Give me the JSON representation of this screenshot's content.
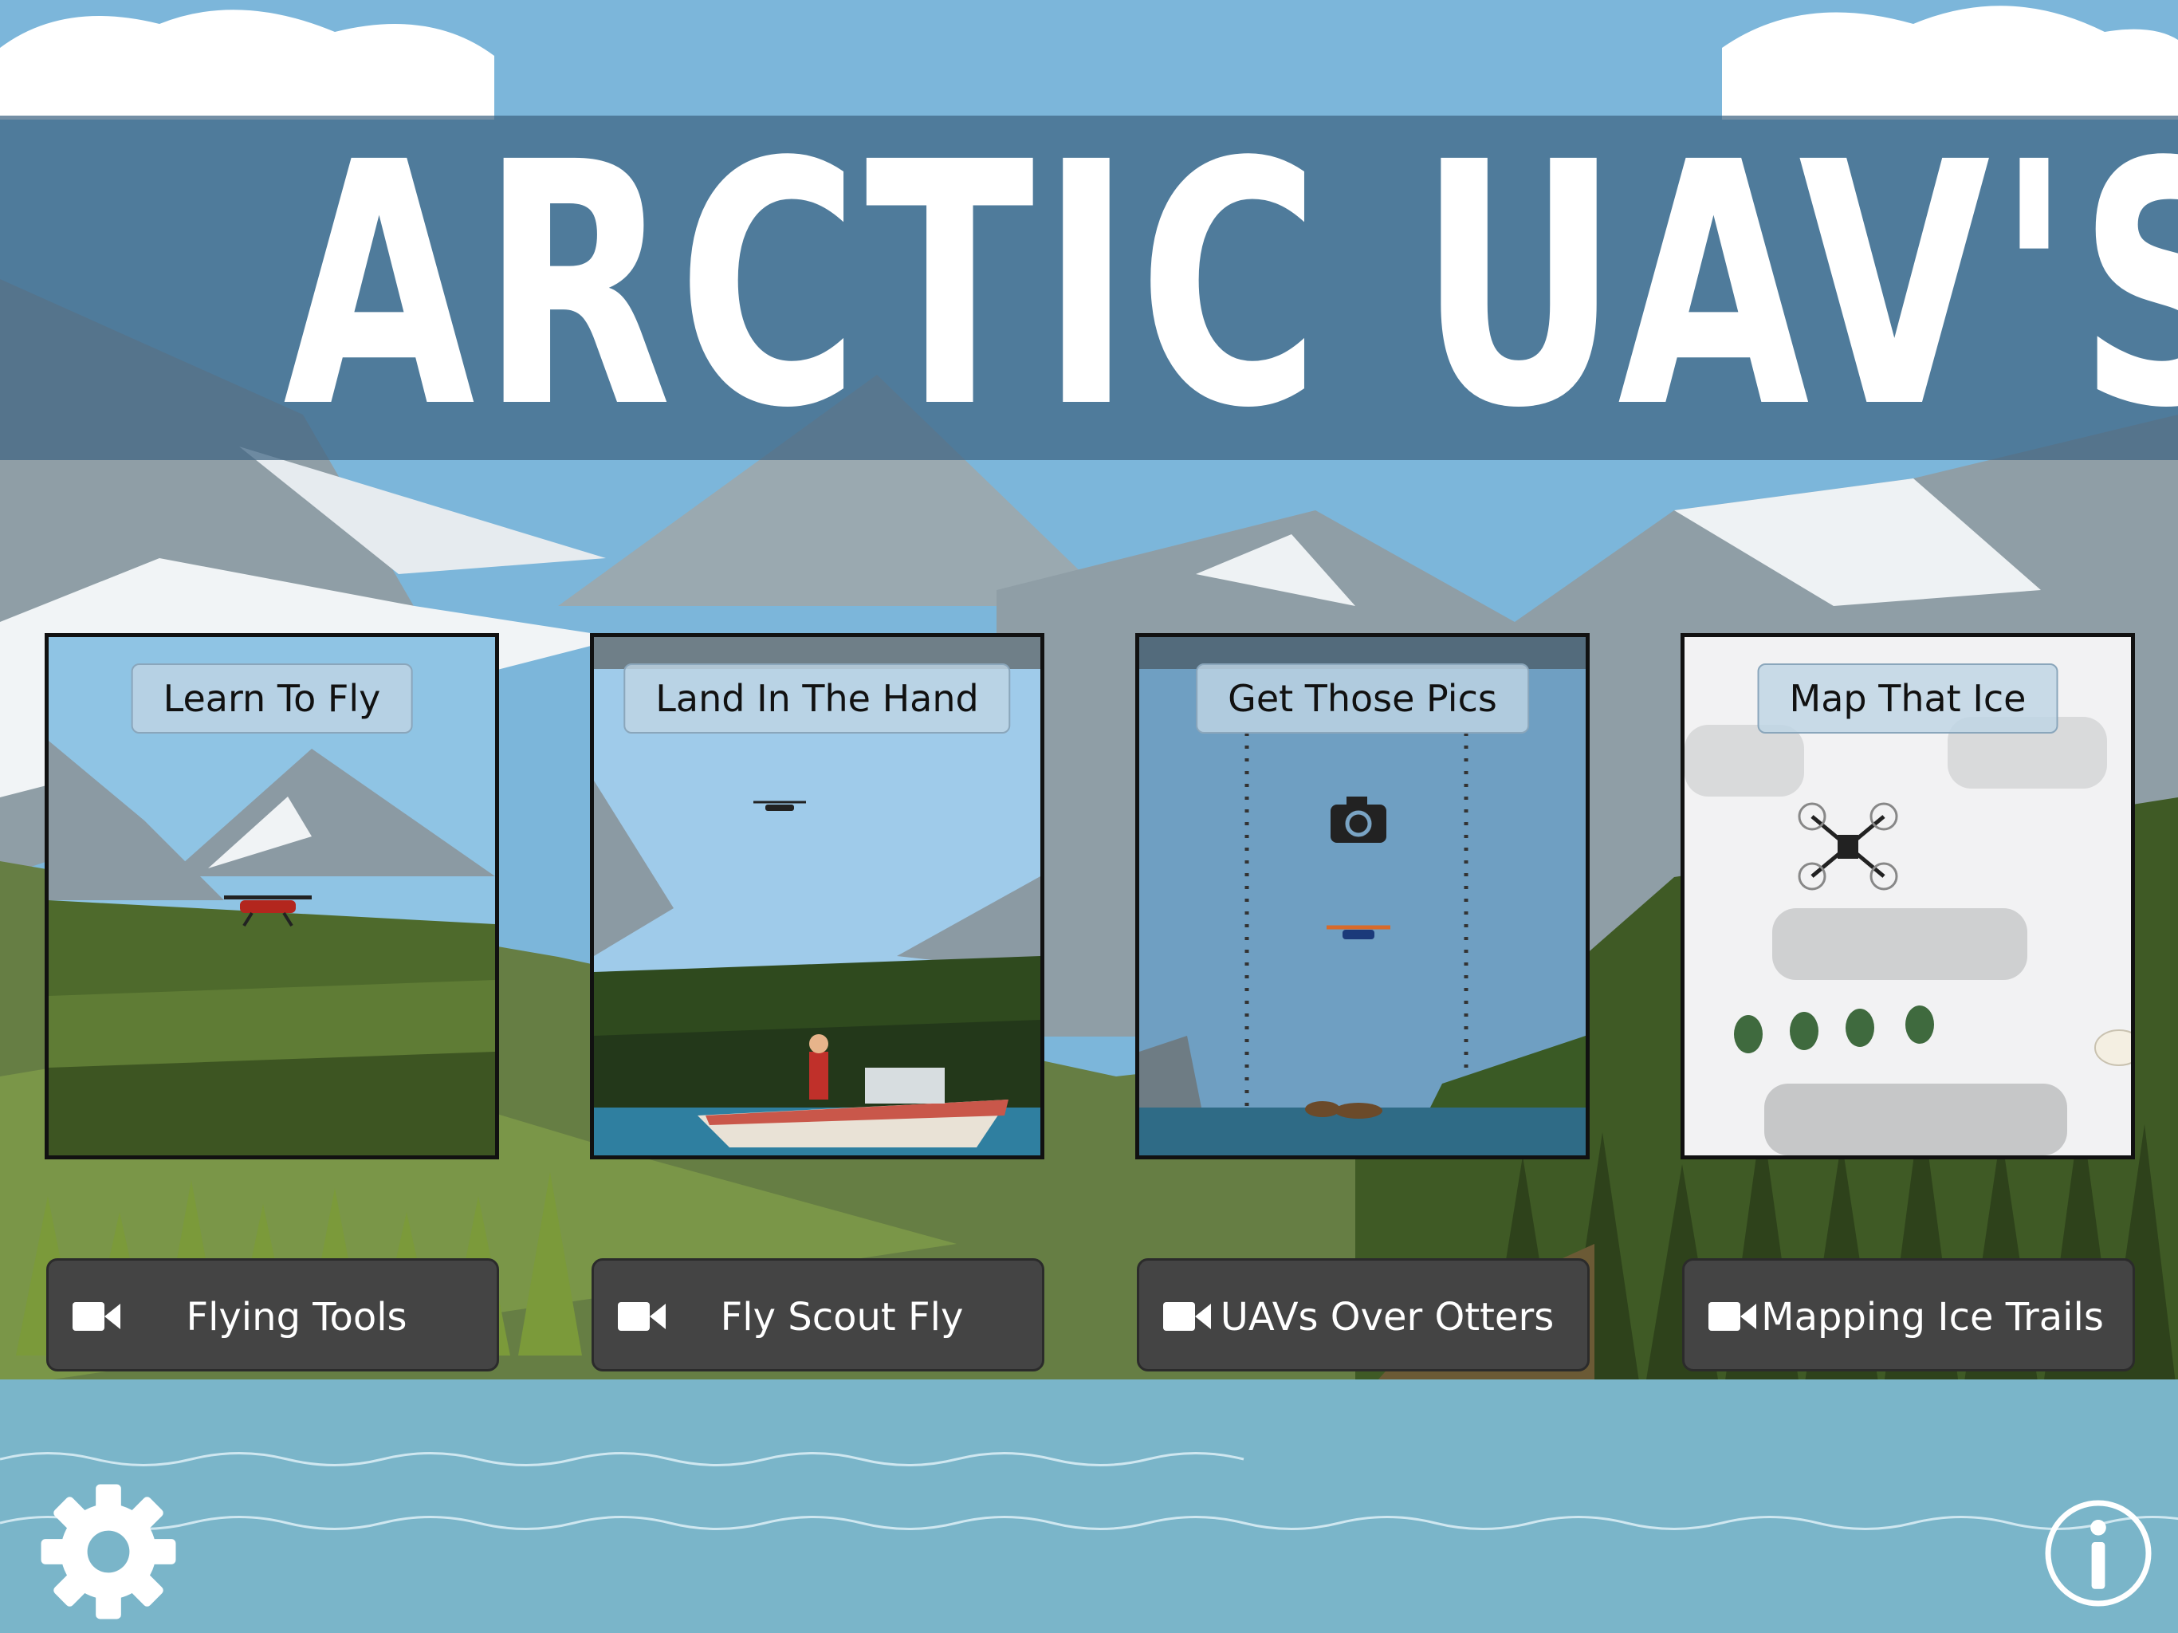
{
  "app": {
    "title": "ARCTIC UAV'S"
  },
  "cards": [
    {
      "label": "Learn To Fly"
    },
    {
      "label": "Land In The Hand"
    },
    {
      "label": "Get Those Pics"
    },
    {
      "label": "Map That Ice"
    }
  ],
  "videos": [
    {
      "label": "Flying Tools",
      "icon": "video-camera-icon"
    },
    {
      "label": "Fly Scout Fly",
      "icon": "video-camera-icon"
    },
    {
      "label": "UAVs Over Otters",
      "icon": "video-camera-icon"
    },
    {
      "label": "Mapping Ice Trails",
      "icon": "video-camera-icon"
    }
  ],
  "controls": {
    "settings_icon": "gear-icon",
    "info_icon": "info-icon"
  },
  "colors": {
    "sky": "#7cb6da",
    "banner": "#3e6482",
    "button": "#444444",
    "water": "#7ab5c9",
    "forest": "#4f6b2a"
  }
}
